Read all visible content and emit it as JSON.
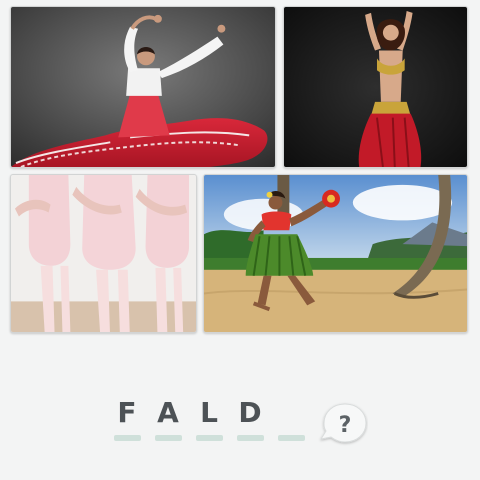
{
  "puzzle": {
    "images": [
      {
        "name": "flamenco-dancer"
      },
      {
        "name": "belly-dancer"
      },
      {
        "name": "ballet-dancers"
      },
      {
        "name": "hula-dancer"
      }
    ],
    "answer_slots": [
      "F",
      "A",
      "L",
      "D",
      ""
    ],
    "hint_symbol": "?"
  },
  "colors": {
    "background": "#f3f4f4",
    "letter": "#4d5256",
    "slot_bar": "#cfe0da",
    "hint_bubble": "#f7f8f8",
    "hint_mark": "#5c6266"
  }
}
